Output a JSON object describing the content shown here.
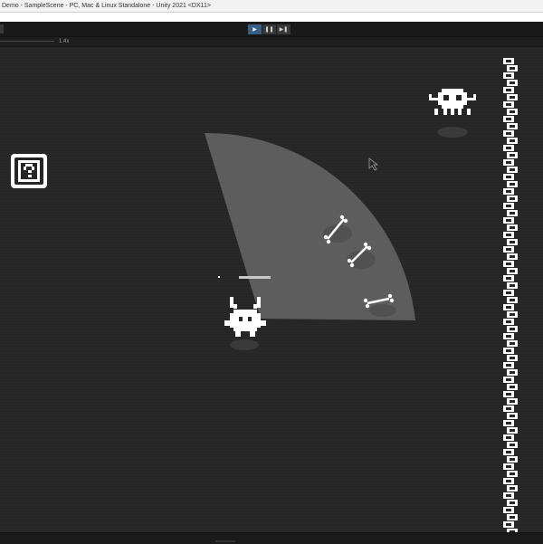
{
  "window": {
    "title": "Demo - SampleScene - PC, Mac & Linux Standalone - Unity 2021 <DX11>"
  },
  "toolbar": {
    "play_icon": "play-icon",
    "pause_icon": "pause-icon",
    "step_icon": "step-icon",
    "play_glyph": "▶",
    "pause_glyph": "❚❚",
    "step_glyph": "▶❚",
    "play_active": true,
    "accent": "#3a5f86"
  },
  "gameview": {
    "scale_label": "1.4x",
    "background": "#262626",
    "vision_cone_color": "#8a8a8a"
  },
  "icons": [
    "mystery-box-icon",
    "player-sprite",
    "skull-enemy-sprite",
    "bone-pickup",
    "cursor-icon",
    "wall-column"
  ]
}
